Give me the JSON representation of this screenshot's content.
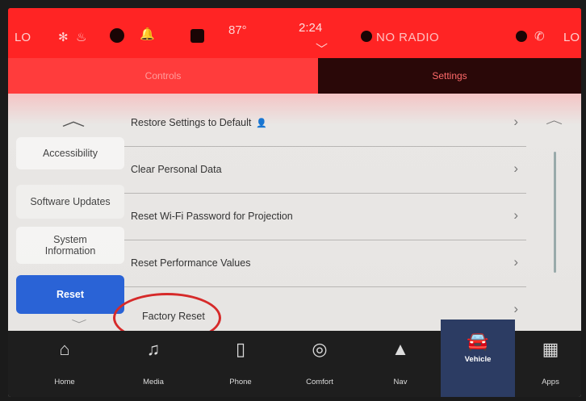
{
  "status_bar": {
    "temp_left": "LO",
    "temp_right": "LO",
    "outside_temp": "87°",
    "time": "2:24",
    "network": "NO RADIO"
  },
  "tabs": [
    {
      "label": "Controls",
      "active": false
    },
    {
      "label": "Settings",
      "active": true
    }
  ],
  "sidebar": {
    "items": [
      {
        "label": "Accessibility"
      },
      {
        "label": "Software Updates"
      },
      {
        "label": "System Information"
      },
      {
        "label": "Reset",
        "active": true
      }
    ]
  },
  "settings_list": {
    "items": [
      {
        "label": "Restore Settings to Default"
      },
      {
        "label": "Clear Personal Data"
      },
      {
        "label": "Reset Wi-Fi Password for Projection"
      },
      {
        "label": "Reset Performance Values"
      },
      {
        "label": "Factory Reset"
      }
    ]
  },
  "bottom_nav": {
    "items": [
      {
        "label": "Home",
        "icon": "home-icon"
      },
      {
        "label": "Media",
        "icon": "music-note-icon"
      },
      {
        "label": "Phone",
        "icon": "phone-icon"
      },
      {
        "label": "Comfort",
        "icon": "comfort-icon"
      },
      {
        "label": "Nav",
        "icon": "nav-arrow-icon"
      },
      {
        "label": "Vehicle",
        "icon": "car-icon",
        "active": true
      },
      {
        "label": "Apps",
        "icon": "apps-grid-icon"
      }
    ]
  },
  "colors": {
    "status_bar": "#ff2424",
    "active_sidebar": "#2a63d6",
    "annotation": "#d62a2a"
  }
}
